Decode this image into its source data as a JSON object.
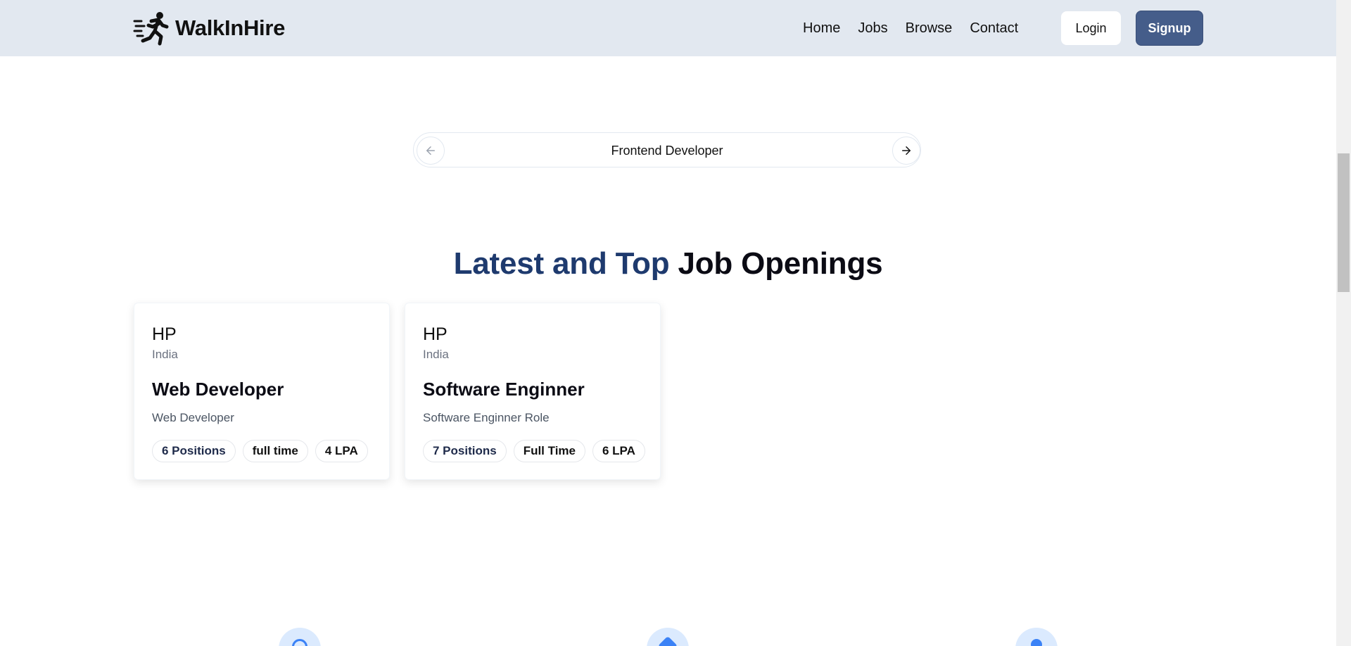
{
  "brand": {
    "name": "WalkInHire",
    "logo_icon": "running-person-icon"
  },
  "nav": {
    "items": [
      "Home",
      "Jobs",
      "Browse",
      "Contact"
    ]
  },
  "auth": {
    "login_label": "Login",
    "signup_label": "Signup"
  },
  "carousel": {
    "current_item": "Frontend Developer",
    "prev_icon": "arrow-left-icon",
    "next_icon": "arrow-right-icon"
  },
  "section": {
    "title_accent": "Latest and Top",
    "title_rest": "Job Openings"
  },
  "jobs": [
    {
      "company": "HP",
      "location": "India",
      "title": "Web Developer",
      "description": "Web Developer",
      "positions": "6 Positions",
      "job_type": "full time",
      "salary": "4 LPA"
    },
    {
      "company": "HP",
      "location": "India",
      "title": "Software Enginner",
      "description": "Software Enginner Role",
      "positions": "7 Positions",
      "job_type": "Full Time",
      "salary": "6 LPA"
    }
  ],
  "colors": {
    "navbar_bg": "#e2e8f0",
    "signup_bg": "#455d8a",
    "title_accent": "#1e3a6e",
    "feature_icon_bg": "#dbeafe"
  }
}
